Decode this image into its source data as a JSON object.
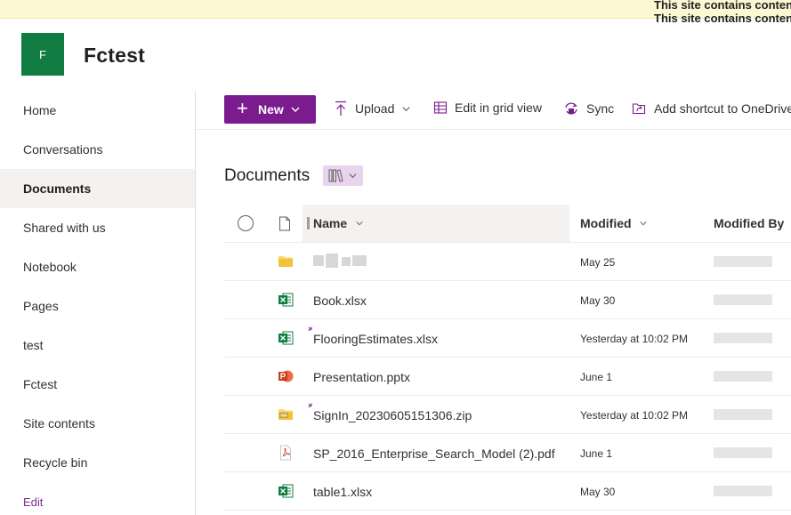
{
  "banner": {
    "line1": "This site contains content",
    "line2": "This site contains content"
  },
  "site": {
    "logo_letter": "F",
    "title": "Fctest",
    "logo_color": "#107c41"
  },
  "nav": {
    "items": [
      {
        "label": "Home"
      },
      {
        "label": "Conversations"
      },
      {
        "label": "Documents",
        "active": true
      },
      {
        "label": "Shared with us"
      },
      {
        "label": "Notebook"
      },
      {
        "label": "Pages"
      },
      {
        "label": "test"
      },
      {
        "label": "Fctest"
      },
      {
        "label": "Site contents"
      },
      {
        "label": "Recycle bin"
      }
    ],
    "edit_label": "Edit"
  },
  "toolbar": {
    "new_label": "New",
    "upload_label": "Upload",
    "grid_label": "Edit in grid view",
    "sync_label": "Sync",
    "shortcut_label": "Add shortcut to OneDrive",
    "accent": "#7a1b8e"
  },
  "library": {
    "title": "Documents"
  },
  "columns": {
    "name": "Name",
    "modified": "Modified",
    "modified_by": "Modified By"
  },
  "files": [
    {
      "icon": "folder-icon",
      "name": "",
      "modified": "May 25",
      "new": false
    },
    {
      "icon": "excel-file-icon",
      "name": "Book.xlsx",
      "modified": "May 30",
      "new": false
    },
    {
      "icon": "excel-file-icon",
      "name": "FlooringEstimates.xlsx",
      "modified": "Yesterday at 10:02 PM",
      "new": true
    },
    {
      "icon": "powerpoint-file-icon",
      "name": "Presentation.pptx",
      "modified": "June 1",
      "new": false
    },
    {
      "icon": "zip-folder-icon",
      "name": "SignIn_20230605151306.zip",
      "modified": "Yesterday at 10:02 PM",
      "new": true
    },
    {
      "icon": "pdf-file-icon",
      "name": "SP_2016_Enterprise_Search_Model (2).pdf",
      "modified": "June 1",
      "new": false
    },
    {
      "icon": "excel-file-icon",
      "name": "table1.xlsx",
      "modified": "May 30",
      "new": false
    }
  ]
}
